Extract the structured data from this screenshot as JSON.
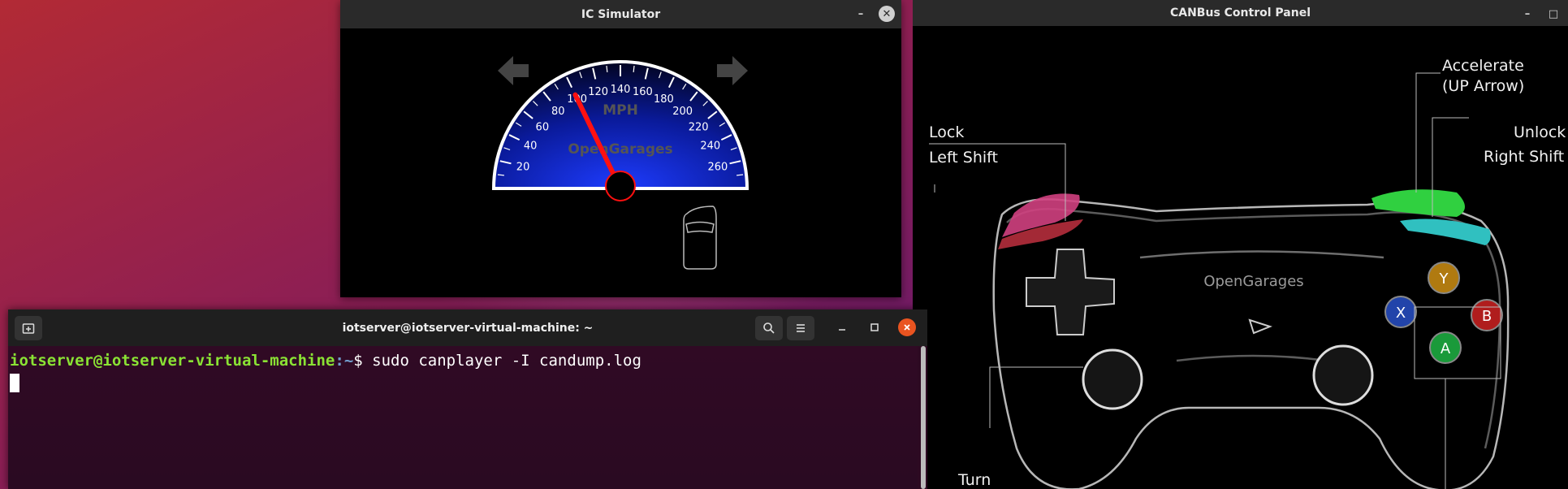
{
  "ic_window": {
    "title": "IC Simulator",
    "minimize_glyph": "–",
    "close_glyph": "✕",
    "speedometer": {
      "unit_label": "MPH",
      "brand_label": "OpenGarages",
      "tick_labels": [
        "20",
        "40",
        "60",
        "80",
        "100",
        "120",
        "140",
        "160",
        "180",
        "200",
        "220",
        "240",
        "260"
      ],
      "max_speed": 280,
      "current_speed": 100
    },
    "icons": [
      "left-turn-signal-icon",
      "right-turn-signal-icon",
      "car-door-icon"
    ]
  },
  "canbus_window": {
    "title": "CANBus Control Panel",
    "minimize_glyph": "–",
    "maximize_glyph": "□",
    "brand_label": "OpenGarages",
    "labels": {
      "lock": "Lock",
      "left_shift": "Left Shift",
      "accelerate": "Accelerate",
      "up_arrow": "(UP Arrow)",
      "unlock": "Unlock",
      "right_shift": "Right Shift",
      "turn": "Turn"
    },
    "buttons": {
      "y": "Y",
      "x": "X",
      "b": "B",
      "a": "A"
    },
    "colors": {
      "y": "#b07a10",
      "x": "#2244aa",
      "b": "#b01d1d",
      "a": "#1a9a3a",
      "lock_trigger": "#d04080",
      "accel_trigger": "#30d040",
      "unlock_trigger": "#30c0c0"
    }
  },
  "terminal": {
    "title": "iotserver@iotserver-virtual-machine: ~",
    "prompt_user": "iotserver@iotserver-virtual-machine",
    "prompt_path": ":~",
    "prompt_symbol": "$ ",
    "command": "sudo canplayer -I candump.log"
  }
}
